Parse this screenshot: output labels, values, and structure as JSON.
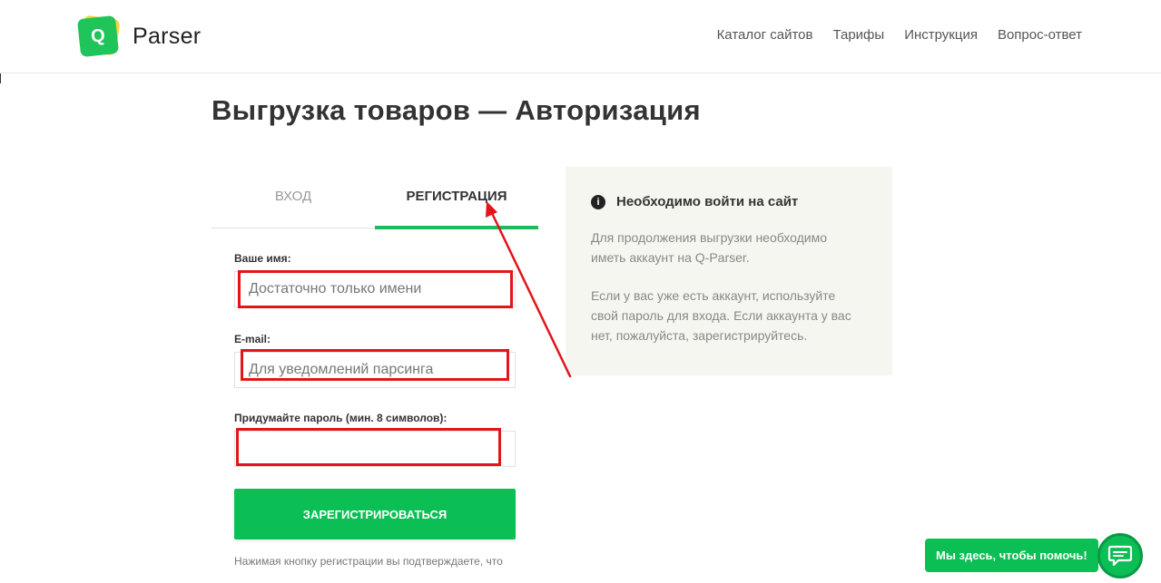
{
  "header": {
    "logo_mark": "Q",
    "logo_text": "Parser",
    "nav": [
      {
        "label": "Каталог сайтов"
      },
      {
        "label": "Тарифы"
      },
      {
        "label": "Инструкция"
      },
      {
        "label": "Вопрос-ответ"
      }
    ]
  },
  "main": {
    "title": "Выгрузка товаров — Авторизация",
    "tabs": {
      "login": "ВХОД",
      "register": "РЕГИСТРАЦИЯ",
      "active": "register"
    },
    "form": {
      "name_label": "Ваше имя:",
      "name_placeholder": "Достаточно только имени",
      "email_label": "E-mail:",
      "email_placeholder": "Для уведомлений парсинга",
      "password_label": "Придумайте пароль (мин. 8 символов):",
      "password_placeholder": "",
      "submit_label": "ЗАРЕГИСТРИРОВАТЬСЯ",
      "consent_text": "Нажимая кнопку регистрации вы подтверждаете, что"
    }
  },
  "info_panel": {
    "icon": "info-icon",
    "icon_glyph": "i",
    "title": "Необходимо войти на сайт",
    "paragraph1": "Для продолжения выгрузки необходимо иметь аккаунт на Q-Parser.",
    "paragraph2": "Если у вас уже есть аккаунт, используйте свой пароль для входа. Если аккаунта у вас нет, пожалуйста, зарегистрируйтесь."
  },
  "chat": {
    "bubble_text": "Мы здесь, чтобы помочь!",
    "icon": "chat-icon"
  },
  "colors": {
    "brand_green": "#0bbf54",
    "annotation_red": "#e3151a",
    "panel_bg": "#f6f6f0",
    "logo_yellow": "#f6d33b"
  }
}
